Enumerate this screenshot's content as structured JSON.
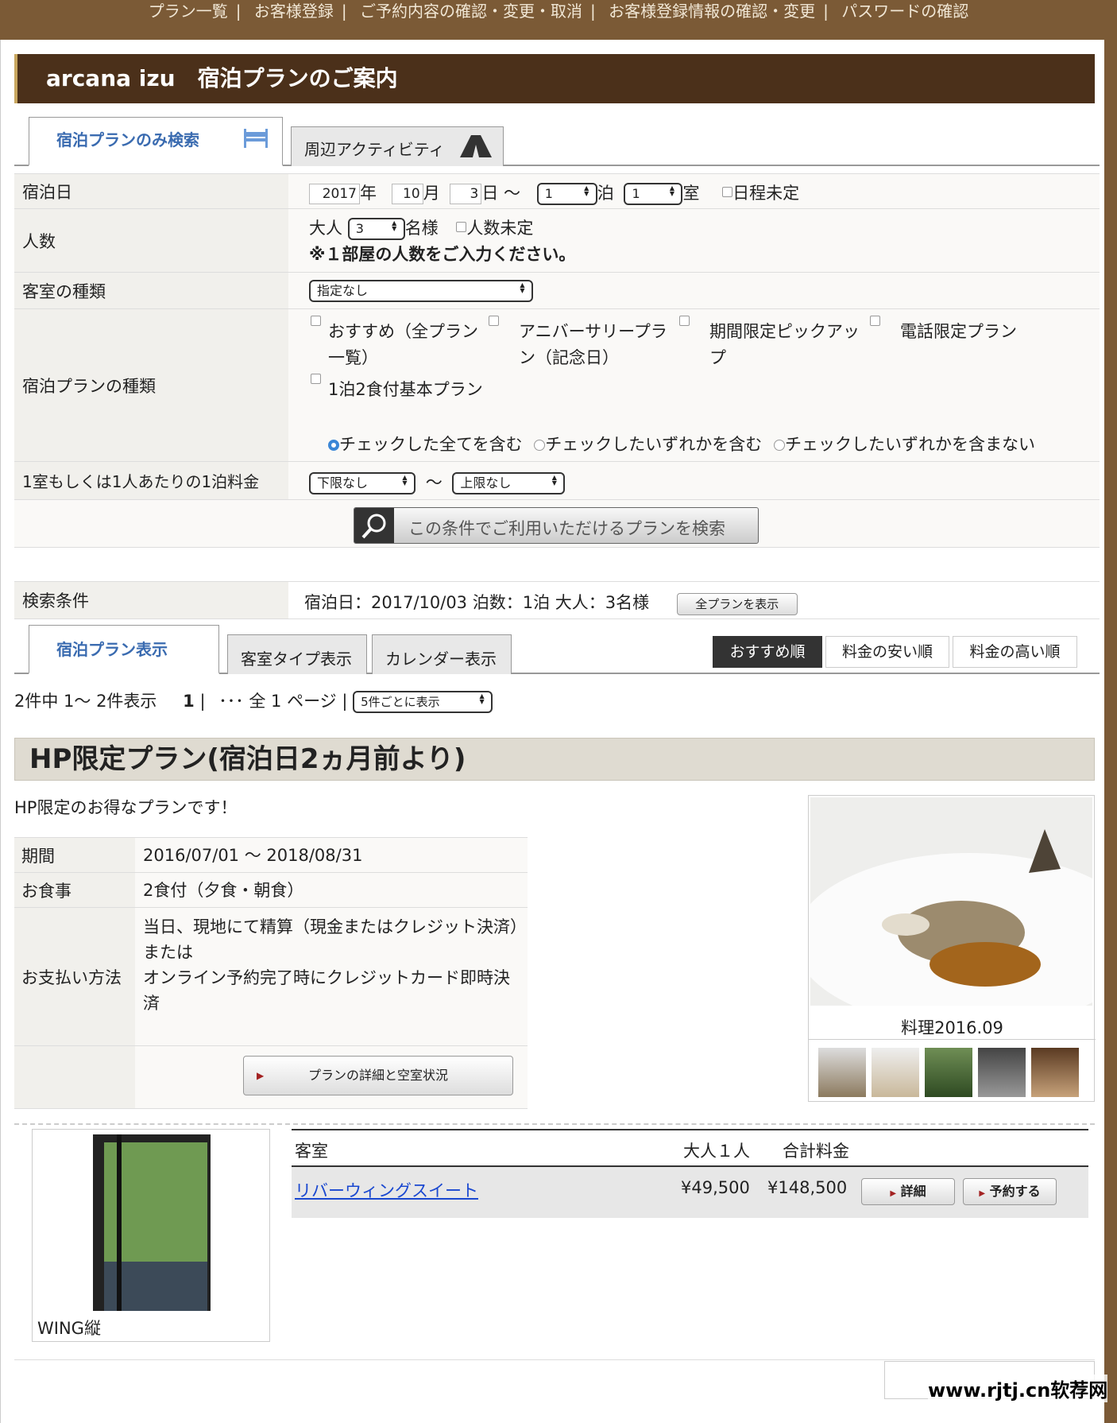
{
  "topnav": {
    "items": [
      "プラン一覧",
      "お客様登録",
      "ご予約内容の確認・変更・取消",
      "お客様登録情報の確認・変更",
      "パスワードの確認"
    ]
  },
  "header": {
    "title": "arcana izu　宿泊プランのご案内"
  },
  "search_tabs": {
    "stay": "宿泊プランのみ検索",
    "activity": "周辺アクティビティ"
  },
  "form": {
    "date_label": "宿泊日",
    "year": "2017",
    "year_unit": "年",
    "month": "10",
    "month_unit": "月",
    "day": "3",
    "day_unit": "日 〜",
    "nights": "1",
    "nights_unit": "泊",
    "rooms": "1",
    "rooms_unit": "室",
    "undecided_date": "日程未定",
    "people_label": "人数",
    "adults_prefix": "大人",
    "adults": "3",
    "adults_unit": "名様",
    "undecided_people": "人数未定",
    "people_note": "※１部屋の人数をご入力ください。",
    "room_type_label": "客室の種類",
    "room_type_value": "指定なし",
    "plan_type_label": "宿泊プランの種類",
    "plan_types": [
      "おすすめ（全プラン一覧）",
      "アニバーサリープラン（記念日）",
      "期間限定ピックアップ",
      "電話限定プラン",
      "1泊2食付基本プラン"
    ],
    "match_options": [
      "チェックした全てを含む",
      "チェックしたいずれかを含む",
      "チェックしたいずれかを含まない"
    ],
    "price_label": "1室もしくは1人あたりの1泊料金",
    "price_min": "下限なし",
    "price_sep": "〜",
    "price_max": "上限なし",
    "search_button": "この条件でご利用いただけるプランを検索"
  },
  "conditions": {
    "label": "検索条件",
    "value": "宿泊日：2017/10/03 泊数：1泊 大人：3名様",
    "show_all": "全プランを表示"
  },
  "view_tabs": {
    "plan": "宿泊プラン表示",
    "room": "客室タイプ表示",
    "calendar": "カレンダー表示"
  },
  "sort": {
    "recommended": "おすすめ順",
    "cheap": "料金の安い順",
    "expensive": "料金の高い順"
  },
  "pagination": {
    "summary": "2件中 1〜 2件表示",
    "current": "1",
    "rest": "･･･ 全 1 ページ |",
    "per_page": "5件ごとに表示"
  },
  "plan": {
    "title": "HP限定プラン(宿泊日2ヵ月前より)",
    "desc": "HP限定のお得なプランです！",
    "period_label": "期間",
    "period": "2016/07/01 〜 2018/08/31",
    "meal_label": "お食事",
    "meal": "2食付（夕食・朝食）",
    "pay_label": "お支払い方法",
    "pay_lines": [
      "当日、現地にて精算（現金またはクレジット決済）",
      "または",
      "オンライン予約完了時にクレジットカード即時決済"
    ],
    "detail_button": "プランの詳細と空室状況",
    "photo_caption": "料理2016.09"
  },
  "rooms_table": {
    "col_room": "客室",
    "col_adult": "大人１人",
    "col_total": "合計料金",
    "room_name": "リバーウィングスイート",
    "adult_price": "¥49,500",
    "total_price": "¥148,500",
    "detail": "詳細",
    "reserve": "予約する",
    "room_photo_caption": "WING縦"
  },
  "watermark": "www.rjtj.cn软荐网",
  "colors": {
    "brand_brown": "#7b5a36",
    "header_dark": "#4b301a",
    "tab_blue": "#3a6bb0",
    "link_blue": "#1a48d0"
  }
}
